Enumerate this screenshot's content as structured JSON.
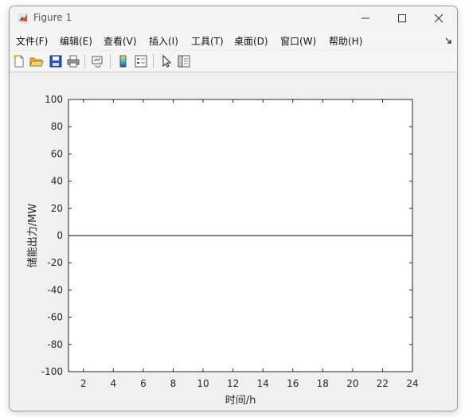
{
  "window": {
    "title": "Figure 1"
  },
  "menu": {
    "items": [
      "文件(F)",
      "编辑(E)",
      "查看(V)",
      "插入(I)",
      "工具(T)",
      "桌面(D)",
      "窗口(W)",
      "帮助(H)"
    ],
    "overflow_icon": "dock-arrow-icon"
  },
  "toolbar": {
    "buttons": [
      "new-figure-icon",
      "open-file-icon",
      "save-icon",
      "print-icon",
      "link-plot-icon",
      "colorbar-icon",
      "legend-icon",
      "pointer-icon",
      "property-editor-icon"
    ]
  },
  "chart_data": {
    "type": "line",
    "title": "",
    "xlabel": "时间/h",
    "ylabel": "储能出力/MW",
    "xlim": [
      1,
      24
    ],
    "ylim": [
      -100,
      100
    ],
    "xticks": [
      2,
      4,
      6,
      8,
      10,
      12,
      14,
      16,
      18,
      20,
      22,
      24
    ],
    "yticks": [
      -100,
      -80,
      -60,
      -40,
      -20,
      0,
      20,
      40,
      60,
      80,
      100
    ],
    "grid": false,
    "series": [
      {
        "x": [
          1,
          2,
          3,
          4,
          5,
          6,
          7,
          8,
          9,
          10,
          11,
          12,
          13,
          14,
          15,
          16,
          17,
          18,
          19,
          20,
          21,
          22,
          23,
          24
        ],
        "y": [
          0,
          0,
          0,
          0,
          0,
          0,
          0,
          0,
          0,
          0,
          0,
          0,
          0,
          0,
          0,
          0,
          0,
          0,
          0,
          0,
          0,
          0,
          0,
          0
        ],
        "color": "#000000"
      }
    ]
  }
}
